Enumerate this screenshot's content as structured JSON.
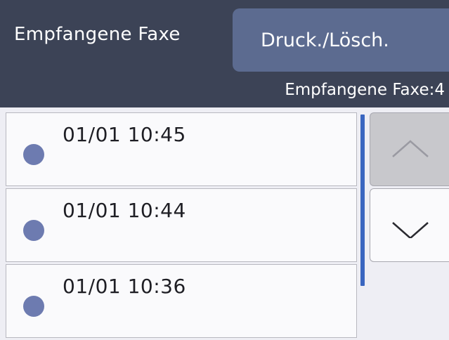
{
  "header": {
    "title": "Empfangene Faxe",
    "action_button_label": "Druck./Lösch.",
    "count_label": "Empfangene Faxe:4"
  },
  "list": {
    "items": [
      {
        "time": "01/01 10:45"
      },
      {
        "time": "01/01 10:44"
      },
      {
        "time": "01/01 10:36"
      }
    ]
  },
  "scroll": {
    "up_icon": "chevron-up-icon",
    "down_icon": "chevron-down-icon",
    "up_enabled": false,
    "down_enabled": true
  },
  "colors": {
    "header_bg": "#3c4356",
    "button_bg": "#5c6b90",
    "dot": "#6d7bb0",
    "scrollbar": "#3a66c0"
  }
}
